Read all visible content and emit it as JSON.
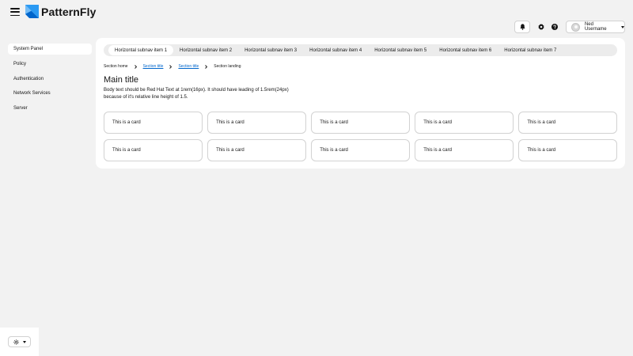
{
  "app": {
    "brand": "PatternFly"
  },
  "header": {
    "notifications_icon": "bell-icon",
    "settings_icon": "gear-icon",
    "help_icon": "question-circle-icon",
    "user_name": "Ned Username"
  },
  "sidebar": {
    "items": [
      {
        "label": "System Panel",
        "active": true
      },
      {
        "label": "Policy"
      },
      {
        "label": "Authentication"
      },
      {
        "label": "Network Services"
      },
      {
        "label": "Server"
      }
    ]
  },
  "subnav": {
    "items": [
      {
        "label": "Horizontal subnav item 1",
        "active": true
      },
      {
        "label": "Horizontal subnav item 2"
      },
      {
        "label": "Horizontal subnav item 3"
      },
      {
        "label": "Horizontal subnav item 4"
      },
      {
        "label": "Horizontal subnav item 5"
      },
      {
        "label": "Horizontal subnav item 6"
      },
      {
        "label": "Horizontal subnav item 7"
      }
    ]
  },
  "breadcrumb": {
    "items": [
      {
        "label": "Section home"
      },
      {
        "label": "Section title"
      },
      {
        "label": "Section title"
      },
      {
        "label": "Section landing"
      }
    ]
  },
  "main": {
    "title": "Main title",
    "body": "Body text should be Red Hat Text at 1rem(16px). It should have leading of 1.5rem(24px) because of it's relative line height of 1.5."
  },
  "cards": [
    "This is a card",
    "This is a card",
    "This is a card",
    "This is a card",
    "This is a card",
    "This is a card",
    "This is a card",
    "This is a card",
    "This is a card",
    "This is a card"
  ],
  "theme_switcher": {
    "icon": "sun-icon"
  },
  "colors": {
    "link": "#0066cc",
    "background": "#f2f2f2",
    "logo_accent": "#2b9af3"
  }
}
